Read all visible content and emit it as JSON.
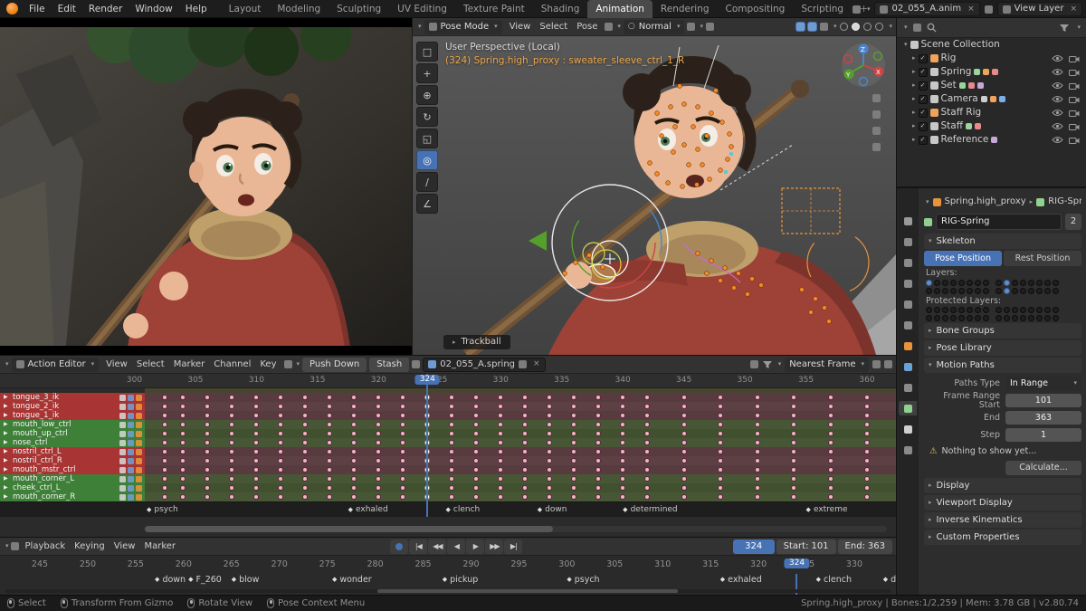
{
  "topbar": {
    "menus": [
      "File",
      "Edit",
      "Render",
      "Window",
      "Help"
    ],
    "workspaces": [
      "Layout",
      "Modeling",
      "Sculpting",
      "UV Editing",
      "Texture Paint",
      "Shading",
      "Animation",
      "Rendering",
      "Compositing",
      "Scripting"
    ],
    "active_workspace": "Animation",
    "scene_name": "02_055_A.anim",
    "view_layer_name": "View Layer"
  },
  "viewport": {
    "header": {
      "mode": "Pose Mode",
      "menus": [
        "View",
        "Select",
        "Pose"
      ],
      "orientation": "Normal"
    },
    "tools": [
      "select-box-tool",
      "cursor-tool",
      "move-tool",
      "rotate-tool",
      "scale-tool",
      "transform-tool",
      "annotate-tool",
      "measure-tool"
    ],
    "active_tool": "transform-tool",
    "shading_modes": [
      "wireframe",
      "solid",
      "material",
      "rendered"
    ],
    "active_shading": "solid",
    "view_label": "User Perspective (Local)",
    "selection_info": "(324) Spring.high_proxy : sweater_sleeve_ctrl_1_R",
    "trackball_label": "Trackball"
  },
  "outliner": {
    "root_label": "Scene Collection",
    "items": [
      {
        "label": "Rig",
        "icon": "armature",
        "extra_icons": []
      },
      {
        "label": "Spring",
        "icon": "collection",
        "extra_icons": [
          "mesh",
          "armature",
          "material"
        ]
      },
      {
        "label": "Set",
        "icon": "collection",
        "extra_icons": [
          "mesh",
          "material",
          "image"
        ]
      },
      {
        "label": "Camera",
        "icon": "collection",
        "extra_icons": [
          "camera",
          "armature",
          "constraint"
        ]
      },
      {
        "label": "Staff Rig",
        "icon": "armature",
        "extra_icons": []
      },
      {
        "label": "Staff",
        "icon": "collection",
        "extra_icons": [
          "mesh",
          "material"
        ]
      },
      {
        "label": "Reference",
        "icon": "collection",
        "extra_icons": [
          "image"
        ]
      }
    ]
  },
  "properties": {
    "tabs": [
      {
        "name": "tool",
        "color": "#9a9a9a"
      },
      {
        "name": "render",
        "color": "#8a8a8a"
      },
      {
        "name": "output",
        "color": "#8a8a8a"
      },
      {
        "name": "view-layer",
        "color": "#8a8a8a"
      },
      {
        "name": "scene",
        "color": "#8a8a8a"
      },
      {
        "name": "world",
        "color": "#8a8a8a"
      },
      {
        "name": "object",
        "color": "#e8923c"
      },
      {
        "name": "physics",
        "color": "#6aa2d8"
      },
      {
        "name": "object-constraints",
        "color": "#8a8a8a"
      },
      {
        "name": "object-data",
        "color": "#8fd18f",
        "active": true
      },
      {
        "name": "bone",
        "color": "#cfcfcf"
      },
      {
        "name": "bone-constraints",
        "color": "#8a8a8a"
      }
    ],
    "breadcrumb": {
      "object": "Spring.high_proxy",
      "data": "RIG-Spring"
    },
    "id_field": {
      "name": "RIG-Spring",
      "users": "2"
    },
    "skeleton_label": "Skeleton",
    "pose_position": "Pose Position",
    "rest_position": "Rest Position",
    "layers_label": "Layers:",
    "protected_layers_label": "Protected Layers:",
    "layers_enabled": [
      0,
      9,
      25
    ],
    "protected_enabled": [],
    "sections_mid": [
      "Bone Groups",
      "Pose Library"
    ],
    "motion_paths_label": "Motion Paths",
    "motion_paths": {
      "paths_type_label": "Paths Type",
      "paths_type_value": "In Range",
      "rows": [
        {
          "label": "Frame Range Start",
          "value": "101"
        },
        {
          "label": "End",
          "value": "363"
        },
        {
          "label": "Step",
          "value": "1"
        }
      ],
      "warning": "Nothing to show yet...",
      "calculate_label": "Calculate..."
    },
    "display_label": "Display",
    "sections_bottom": [
      "Viewport Display",
      "Inverse Kinematics",
      "Custom Properties"
    ]
  },
  "dopesheet": {
    "editor_label": "Action Editor",
    "menus": [
      "View",
      "Select",
      "Marker",
      "Channel",
      "Key"
    ],
    "push_down": "Push Down",
    "stash": "Stash",
    "action_name": "02_055_A.spring",
    "nearest_frame": "Nearest Frame",
    "view_start": 299,
    "view_end": 362,
    "ruler_ticks": [
      300,
      305,
      310,
      315,
      320,
      325,
      330,
      335,
      340,
      345,
      350,
      355,
      360
    ],
    "current_frame": 324,
    "channels": [
      {
        "name": "tongue_3_ik",
        "group": "red"
      },
      {
        "name": "tongue_2_ik",
        "group": "red"
      },
      {
        "name": "tongue_1_ik",
        "group": "red"
      },
      {
        "name": "mouth_low_ctrl",
        "group": "green"
      },
      {
        "name": "mouth_up_ctrl",
        "group": "green"
      },
      {
        "name": "nose_ctrl",
        "group": "green"
      },
      {
        "name": "nostril_ctrl_L",
        "group": "red"
      },
      {
        "name": "nostril_ctrl_R",
        "group": "red"
      },
      {
        "name": "mouth_mstr_ctrl",
        "group": "red"
      },
      {
        "name": "mouth_corner_L",
        "group": "green"
      },
      {
        "name": "cheek_ctrl_L",
        "group": "green"
      },
      {
        "name": "mouth_corner_R",
        "group": "green"
      }
    ],
    "key_frames": [
      301,
      302.5,
      304,
      306,
      308,
      310,
      312,
      314,
      316,
      318,
      320,
      322,
      324,
      326,
      328,
      330,
      332,
      334,
      336,
      338,
      340,
      342,
      345,
      348,
      351,
      354,
      357,
      360
    ],
    "markers": [
      {
        "label": "psych",
        "frame": 301
      },
      {
        "label": "exhaled",
        "frame": 317.5
      },
      {
        "label": "clench",
        "frame": 325.5
      },
      {
        "label": "down",
        "frame": 333
      },
      {
        "label": "determined",
        "frame": 340
      },
      {
        "label": "extreme",
        "frame": 355
      }
    ]
  },
  "timeline": {
    "menus": [
      "Playback",
      "Keying",
      "View",
      "Marker"
    ],
    "transport": [
      "autokey",
      "jump-start",
      "prev-keyframe",
      "play-reverse",
      "play",
      "next-keyframe",
      "jump-end"
    ],
    "current_frame": "324",
    "start_label": "Start:",
    "start_value": "101",
    "end_label": "End:",
    "end_value": "363",
    "view_start": 245,
    "view_end": 330,
    "ticks": [
      245,
      250,
      255,
      260,
      265,
      270,
      275,
      280,
      285,
      290,
      295,
      300,
      305,
      310,
      315,
      320,
      325,
      330
    ],
    "markers": [
      {
        "label": "down",
        "frame": 257
      },
      {
        "label": "F_260",
        "frame": 260.5
      },
      {
        "label": "blow",
        "frame": 265
      },
      {
        "label": "wonder",
        "frame": 275.5
      },
      {
        "label": "pickup",
        "frame": 287
      },
      {
        "label": "psych",
        "frame": 300
      },
      {
        "label": "exhaled",
        "frame": 316
      },
      {
        "label": "clench",
        "frame": 326
      },
      {
        "label": "down",
        "frame": 333
      }
    ],
    "current_badge": "324"
  },
  "statusbar": {
    "items": [
      {
        "label": "Select",
        "button": "left"
      },
      {
        "label": "Transform From Gizmo",
        "button": "left"
      },
      {
        "label": "Rotate View",
        "button": "mid"
      },
      {
        "label": "Pose Context Menu",
        "button": "right"
      }
    ],
    "right": "Spring.high_proxy  |  Bones:1/2,259  |  Mem: 3.78 GB  |  v2.80.74"
  },
  "colors": {
    "accent": "#4772b3",
    "selection_orange": "#eda64a",
    "channel_red": "#a83434",
    "channel_green": "#3f8038",
    "key_dot": "#efb6c3"
  }
}
